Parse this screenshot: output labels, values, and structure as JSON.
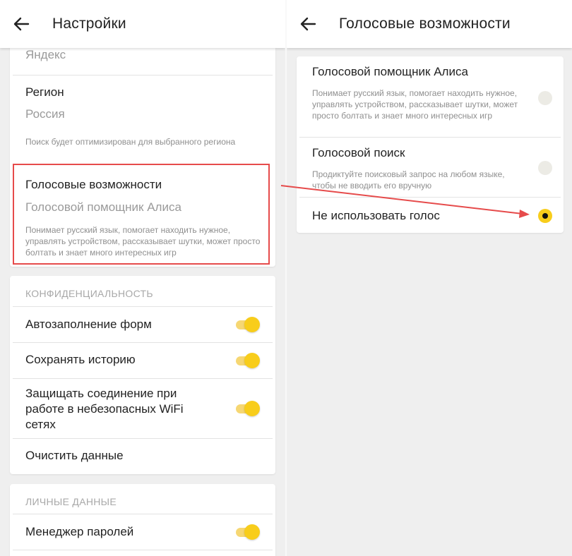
{
  "left": {
    "title": "Настройки",
    "top_card": {
      "partial_label": "Яндекс",
      "region_title": "Регион",
      "region_value": "Россия",
      "region_desc": "Поиск будет оптимизирован для выбранного региона",
      "voice_title": "Голосовые возможности",
      "voice_value": "Голосовой помощник Алиса",
      "voice_desc": "Понимает русский язык, помогает находить нужное, управлять устройством, рассказывает шутки, может просто болтать и знает много интересных игр"
    },
    "privacy": {
      "header": "КОНФИДЕНЦИАЛЬНОСТЬ",
      "items": [
        {
          "label": "Автозаполнение форм",
          "enabled": true
        },
        {
          "label": "Сохранять историю",
          "enabled": true
        },
        {
          "label": "Защищать соединение при работе в небезопасных WiFi сетях",
          "enabled": true
        }
      ],
      "clear_label": "Очистить данные"
    },
    "personal": {
      "header": "ЛИЧНЫЕ ДАННЫЕ",
      "items": [
        {
          "label": "Менеджер паролей",
          "enabled": true
        }
      ]
    }
  },
  "right": {
    "title": "Голосовые возможности",
    "options": [
      {
        "title": "Голосовой помощник Алиса",
        "desc": "Понимает русский язык, помогает находить нужное, управлять устройством, рассказывает шутки, может просто болтать и знает много интересных игр",
        "selected": false
      },
      {
        "title": "Голосовой поиск",
        "desc": "Продиктуйте поисковый запрос на любом языке, чтобы не вводить его вручную",
        "selected": false
      },
      {
        "title": "Не использовать голос",
        "desc": "",
        "selected": true
      }
    ]
  },
  "colors": {
    "accent": "#f8cd1b",
    "annotation": "#e64b4b"
  },
  "icons": {
    "back": "arrow-left-icon"
  }
}
